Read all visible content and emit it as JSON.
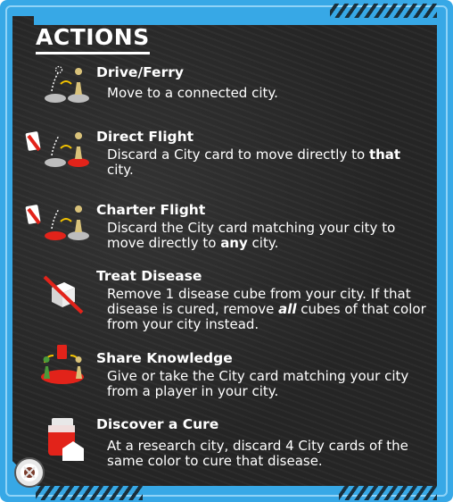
{
  "title": "ACTIONS",
  "actions": [
    {
      "name": "Drive/Ferry",
      "desc": "Move to a connected city.",
      "icon": "drive-ferry-icon"
    },
    {
      "name": "Direct Flight",
      "desc_a": "Discard a City card to move directly to ",
      "desc_b": "that",
      "desc_c": " city.",
      "icon": "direct-flight-icon"
    },
    {
      "name": "Charter Flight",
      "desc_a": "Discard the City card matching your city to move directly to ",
      "desc_b": "any",
      "desc_c": " city.",
      "icon": "charter-flight-icon"
    },
    {
      "name": "Treat Disease",
      "desc_a": "Remove 1 disease cube from your city. If that disease is cured, remove ",
      "desc_b": "all",
      "desc_c": " cubes of that color from your city instead.",
      "icon": "treat-disease-icon"
    },
    {
      "name": "Share Knowledge",
      "desc": "Give or take the City card matching your city from a player in your city.",
      "icon": "share-knowledge-icon"
    },
    {
      "name": "Discover a Cure",
      "desc": "At a research city, discard 4 City cards of the same color to cure that disease.",
      "icon": "discover-cure-icon"
    }
  ],
  "colors": {
    "frame": "#37a8e6",
    "panel": "#252525",
    "red": "#e2231a",
    "pawn": "#d9c27a"
  }
}
